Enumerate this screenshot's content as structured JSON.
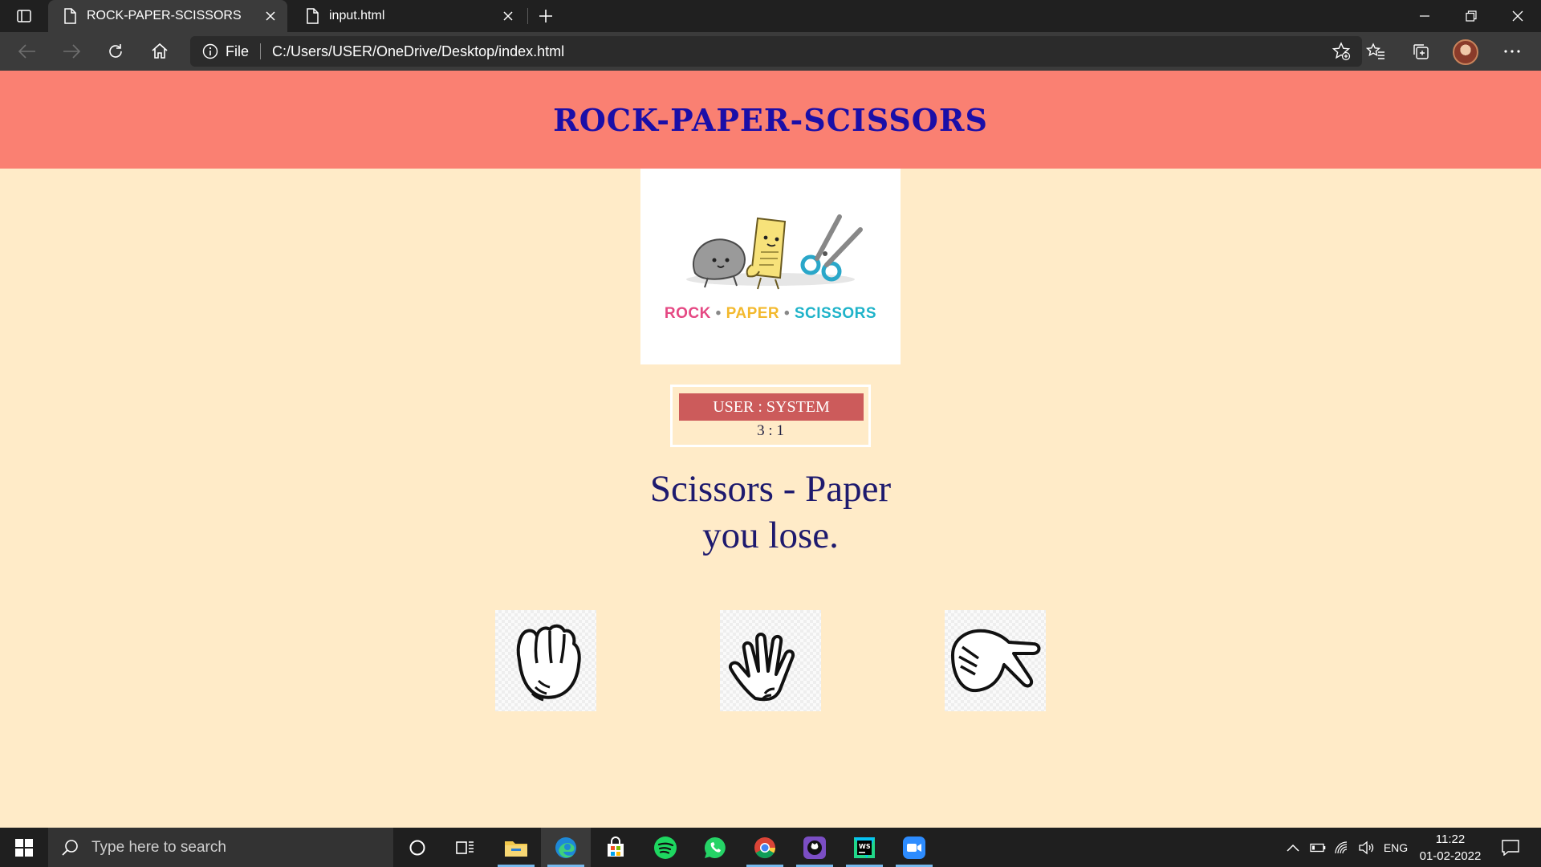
{
  "browser": {
    "tabs": [
      {
        "title": "ROCK-PAPER-SCISSORS",
        "active": true
      },
      {
        "title": "input.html",
        "active": false
      }
    ],
    "address": {
      "scheme": "File",
      "url": "C:/Users/USER/OneDrive/Desktop/index.html"
    }
  },
  "page": {
    "header_title": "ROCK-PAPER-SCISSORS",
    "logo_text": {
      "rock": "ROCK",
      "paper": "PAPER",
      "scissors": "SCISSORS",
      "separator": "•"
    },
    "score": {
      "label": "USER : SYSTEM",
      "value": "3 : 1"
    },
    "result": {
      "line1": "Scissors - Paper",
      "line2": "you lose."
    },
    "choices": [
      {
        "name": "rock",
        "icon": "rock-hand-icon"
      },
      {
        "name": "paper",
        "icon": "paper-hand-icon"
      },
      {
        "name": "scissors",
        "icon": "scissors-hand-icon"
      }
    ],
    "colors": {
      "header_bg": "#fa8072",
      "page_bg": "#ffebc8",
      "title": "#1a0ea8",
      "score_label_bg": "#cc5b5b",
      "result_text": "#1e1a6e"
    }
  },
  "taskbar": {
    "search_placeholder": "Type here to search",
    "apps": [
      "cortana-icon",
      "task-view-icon",
      "file-explorer-icon",
      "edge-icon",
      "store-icon",
      "spotify-icon",
      "whatsapp-icon",
      "chrome-icon",
      "github-desktop-icon",
      "webstorm-icon",
      "zoom-icon"
    ],
    "language": "ENG",
    "time": "11:22",
    "date": "01-02-2022"
  }
}
